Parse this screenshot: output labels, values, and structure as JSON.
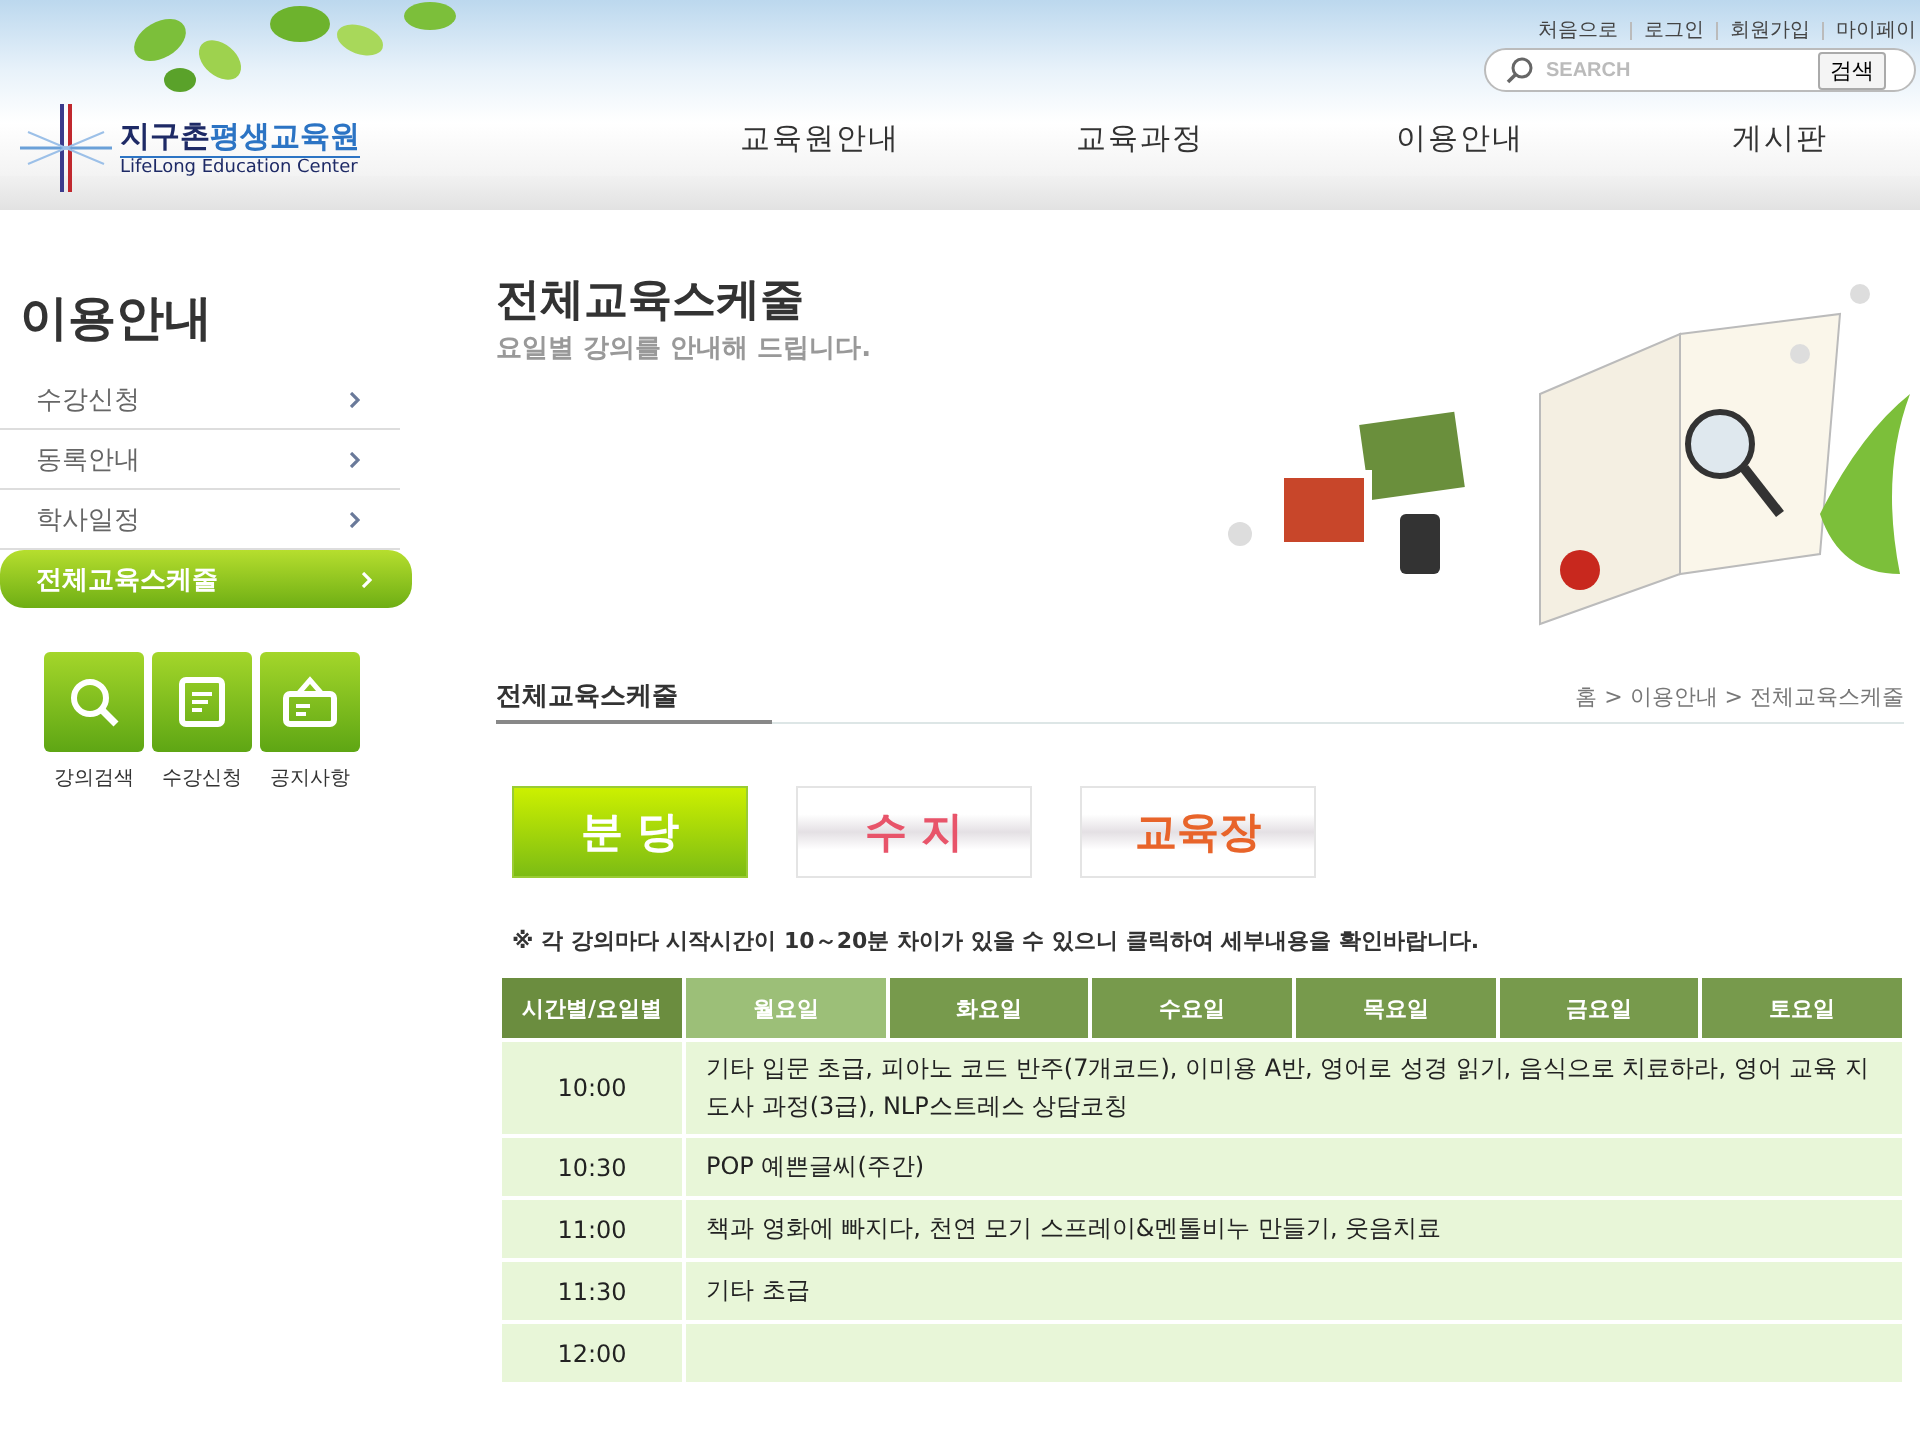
{
  "header": {
    "top_links": [
      "처음으로",
      "로그인",
      "회원가입",
      "마이페이"
    ],
    "search": {
      "placeholder": "SEARCH",
      "button": "검색"
    },
    "logo": {
      "title_dark": "지구촌",
      "title_blue": "평생교육원",
      "subtitle": "LifeLong Education Center"
    },
    "nav": [
      "교육원안내",
      "교육과정",
      "이용안내",
      "게시판"
    ]
  },
  "sidebar": {
    "title": "이용안내",
    "items": [
      {
        "label": "수강신청",
        "selected": false
      },
      {
        "label": "동록안내",
        "selected": false
      },
      {
        "label": "학사일정",
        "selected": false
      },
      {
        "label": "전체교육스케줄",
        "selected": true
      }
    ],
    "quick_links": [
      {
        "label": "강의검색",
        "kind": "search"
      },
      {
        "label": "수강신청",
        "kind": "form"
      },
      {
        "label": "공지사항",
        "kind": "notice"
      }
    ]
  },
  "page": {
    "title": "전체교육스케줄",
    "subtitle": "요일별 강의를 안내해 드립니다.",
    "section_title": "전체교육스케줄",
    "breadcrumb": "홈 > 이용안내 > 전체교육스케줄",
    "branches": [
      {
        "label": "분 당",
        "selected": true,
        "color": "#ffffff"
      },
      {
        "label": "수 지",
        "selected": false,
        "color": "#e8546a"
      },
      {
        "label": "교육장",
        "selected": false,
        "color": "#e8642a"
      }
    ],
    "note": "※ 각 강의마다 시작시간이 10～20분 차이가 있을 수 있으니 클릭하여 세부내용을 확인바랍니다.",
    "table": {
      "corner": "시간별/요일별",
      "columns": [
        {
          "label": "월요일",
          "selected": true
        },
        {
          "label": "화요일",
          "selected": false
        },
        {
          "label": "수요일",
          "selected": false
        },
        {
          "label": "목요일",
          "selected": false
        },
        {
          "label": "금요일",
          "selected": false
        },
        {
          "label": "토요일",
          "selected": false
        }
      ],
      "rows": [
        {
          "time": "10:00",
          "classes": "기타 입문 초급, 피아노 코드 반주(7개코드), 이미용 A반, 영어로 성경 읽기, 음식으로 치료하라, 영어 교육 지도사 과정(3급), NLP스트레스 상담코칭"
        },
        {
          "time": "10:30",
          "classes": "POP 예쁜글씨(주간)"
        },
        {
          "time": "11:00",
          "classes": "책과 영화에 빠지다, 천연 모기 스프레이&멘톨비누 만들기, 웃음치료"
        },
        {
          "time": "11:30",
          "classes": "기타 초급"
        },
        {
          "time": "12:00"
        }
      ]
    }
  }
}
